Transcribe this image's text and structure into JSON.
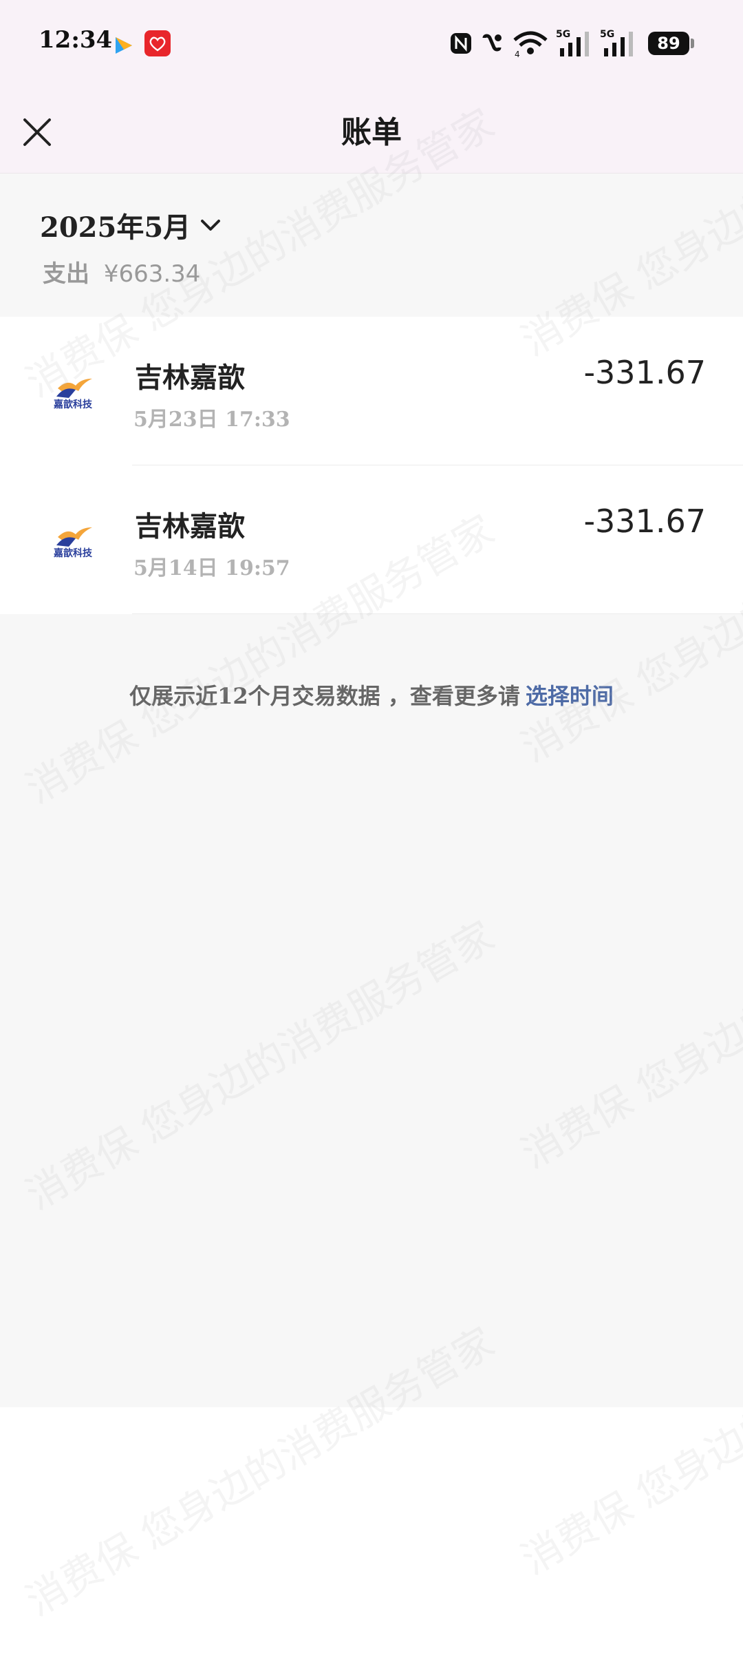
{
  "status_bar": {
    "time": "12:34",
    "battery": "89",
    "network_labels": [
      "5G",
      "5G"
    ],
    "wifi_label": "4"
  },
  "header": {
    "title": "账单"
  },
  "summary": {
    "month": "2025年5月",
    "expense_label": "支出",
    "expense_amount": "¥663.34"
  },
  "transactions": [
    {
      "merchant": "吉林嘉歆",
      "time": "5月23日 17:33",
      "amount": "-331.67",
      "logo_text": "嘉歆科技"
    },
    {
      "merchant": "吉林嘉歆",
      "time": "5月14日 19:57",
      "amount": "-331.67",
      "logo_text": "嘉歆科技"
    }
  ],
  "footer": {
    "note": "仅展示近12个月交易数据 ，查看更多请",
    "link": "选择时间"
  },
  "watermark": {
    "text": "消费保 您身边的消费服务管家"
  },
  "colors": {
    "header_bg": "#f9f2f8",
    "content_bg": "#f7f7f7",
    "link": "#4e6ba6",
    "app_red": "#e8262b"
  }
}
